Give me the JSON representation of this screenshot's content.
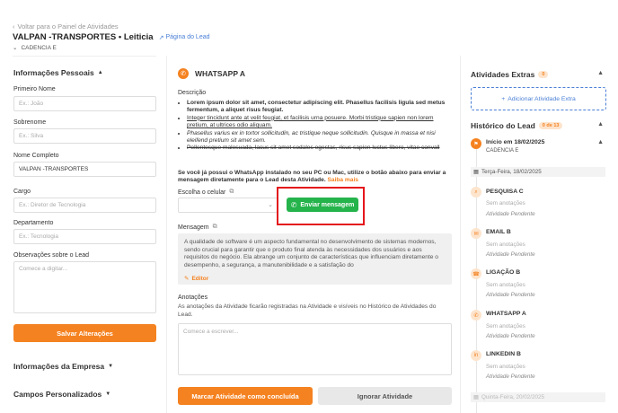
{
  "header": {
    "back_label": "Voltar para o Painel de Atividades",
    "title": "VALPAN -TRANSPORTES • Leiticia",
    "lead_link": "Página do Lead",
    "cadence": "CADENCIA E"
  },
  "personal": {
    "title": "Informações Pessoais",
    "fields": [
      {
        "label": "Primeiro Nome",
        "value": "",
        "placeholder": "Ex.: João"
      },
      {
        "label": "Sobrenome",
        "value": "",
        "placeholder": "Ex.: Silva"
      },
      {
        "label": "Nome Completo",
        "value": "VALPAN -TRANSPORTES",
        "placeholder": ""
      },
      {
        "label": "Cargo",
        "value": "",
        "placeholder": "Ex.: Diretor de Tecnologia"
      },
      {
        "label": "Departamento",
        "value": "",
        "placeholder": "Ex.: Tecnologia"
      }
    ],
    "notes_label": "Observações sobre o Lead",
    "notes_placeholder": "Comece a digitar...",
    "save_button": "Salvar Alterações"
  },
  "company_section": "Informações da Empresa",
  "custom_section": "Campos Personalizados",
  "activity": {
    "title": "WHATSAPP A",
    "description_label": "Descrição",
    "description": [
      "Lorem ipsum dolor sit amet, consectetur adipiscing elit. Phasellus facilisis ligula sed metus fermentum, a aliquet risus feugiat.",
      "Integer tincidunt ante at velit feugiat, et facilisis urna posuere. Morbi tristique sapien non lorem pretium, at ultrices odio aliquam.",
      "Phasellus varius ex in tortor sollicitudin, ac tristique neque sollicitudin. Quisque in massa et nisi eleifend pretium sit amet sem.",
      "Pellentesque malesuada, lacus sit amet sodales egestas, risus sapien luctus libero, vitae convall"
    ],
    "info_text": "Se você já possui o WhatsApp instalado no seu PC ou Mac, utilize o botão abaixo para enviar a mensagem diretamente para o Lead desta Atividade.",
    "learn_more": "Saiba mais",
    "choose_phone_label": "Escolha o celular",
    "send_button": "Enviar mensagem",
    "message_label": "Mensagem",
    "message_text": "A qualidade de software é um aspecto fundamental no desenvolvimento de sistemas modernos, sendo crucial para garantir que o produto final atenda às necessidades dos usuários e aos requisitos do negócio. Ela abrange um conjunto de características que influenciam diretamente o desempenho, a segurança, a manutenibilidade e a satisfação do",
    "editor_label": "Editor",
    "notes_label": "Anotações",
    "notes_desc": "As anotações da Atividade ficarão registradas na Atividade e visíveis no Histórico de Atividades do Lead.",
    "notes_placeholder": "Comece a escrever...",
    "complete_button": "Marcar Atividade como concluída",
    "ignore_button": "Ignorar Atividade"
  },
  "extras": {
    "title": "Atividades Extras",
    "count": "0",
    "add_button": "Adicionar Atividade Extra"
  },
  "history": {
    "title": "Histórico do Lead",
    "badge": "0 de 13",
    "start_title": "Início em 18/02/2025",
    "start_sub": "CADENCIA E",
    "date1": "Terça-Feira, 18/02/2025",
    "items": [
      {
        "title": "PESQUISA C",
        "notes": "Sem anotações",
        "status": "Atividade Pendente"
      },
      {
        "title": "EMAIL B",
        "notes": "Sem anotações",
        "status": "Atividade Pendente"
      },
      {
        "title": "LIGAÇÃO B",
        "notes": "Sem anotações",
        "status": "Atividade Pendente"
      },
      {
        "title": "WHATSAPP A",
        "notes": "Sem anotações",
        "status": "Atividade Pendente"
      },
      {
        "title": "LINKEDIN B",
        "notes": "Sem anotações",
        "status": "Atividade Pendente"
      }
    ],
    "date2": "Quinta-Feira, 20/02/2025"
  },
  "colors": {
    "accent": "#f58220",
    "whatsapp": "#25b34b",
    "highlight": "#e4161b",
    "link": "#4a7fd6"
  }
}
